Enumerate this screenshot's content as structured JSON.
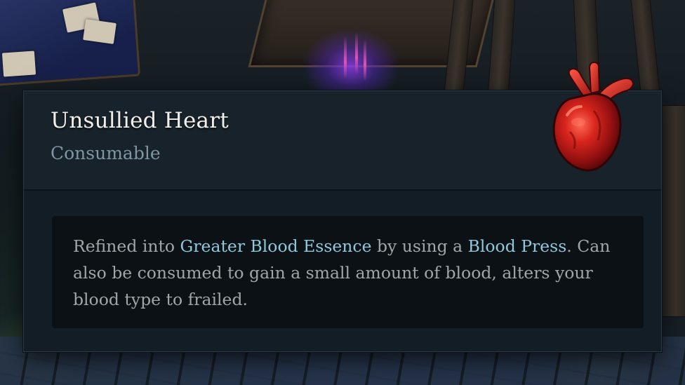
{
  "tooltip": {
    "title": "Unsullied Heart",
    "category": "Consumable",
    "icon": "heart-icon",
    "description": {
      "part1": "Refined into ",
      "highlight1": "Greater Blood Essence",
      "part2": " by using a ",
      "highlight2": "Blood Press",
      "part3": ". Can also be consumed to gain a small amount of blood, alters your blood type to frailed."
    }
  },
  "colors": {
    "title": "#f1efe9",
    "category": "#7f96a1",
    "body_text": "#a2a6a6",
    "highlight": "#8ec9dc",
    "panel": "#131d25",
    "description_box": "#0b1115"
  }
}
